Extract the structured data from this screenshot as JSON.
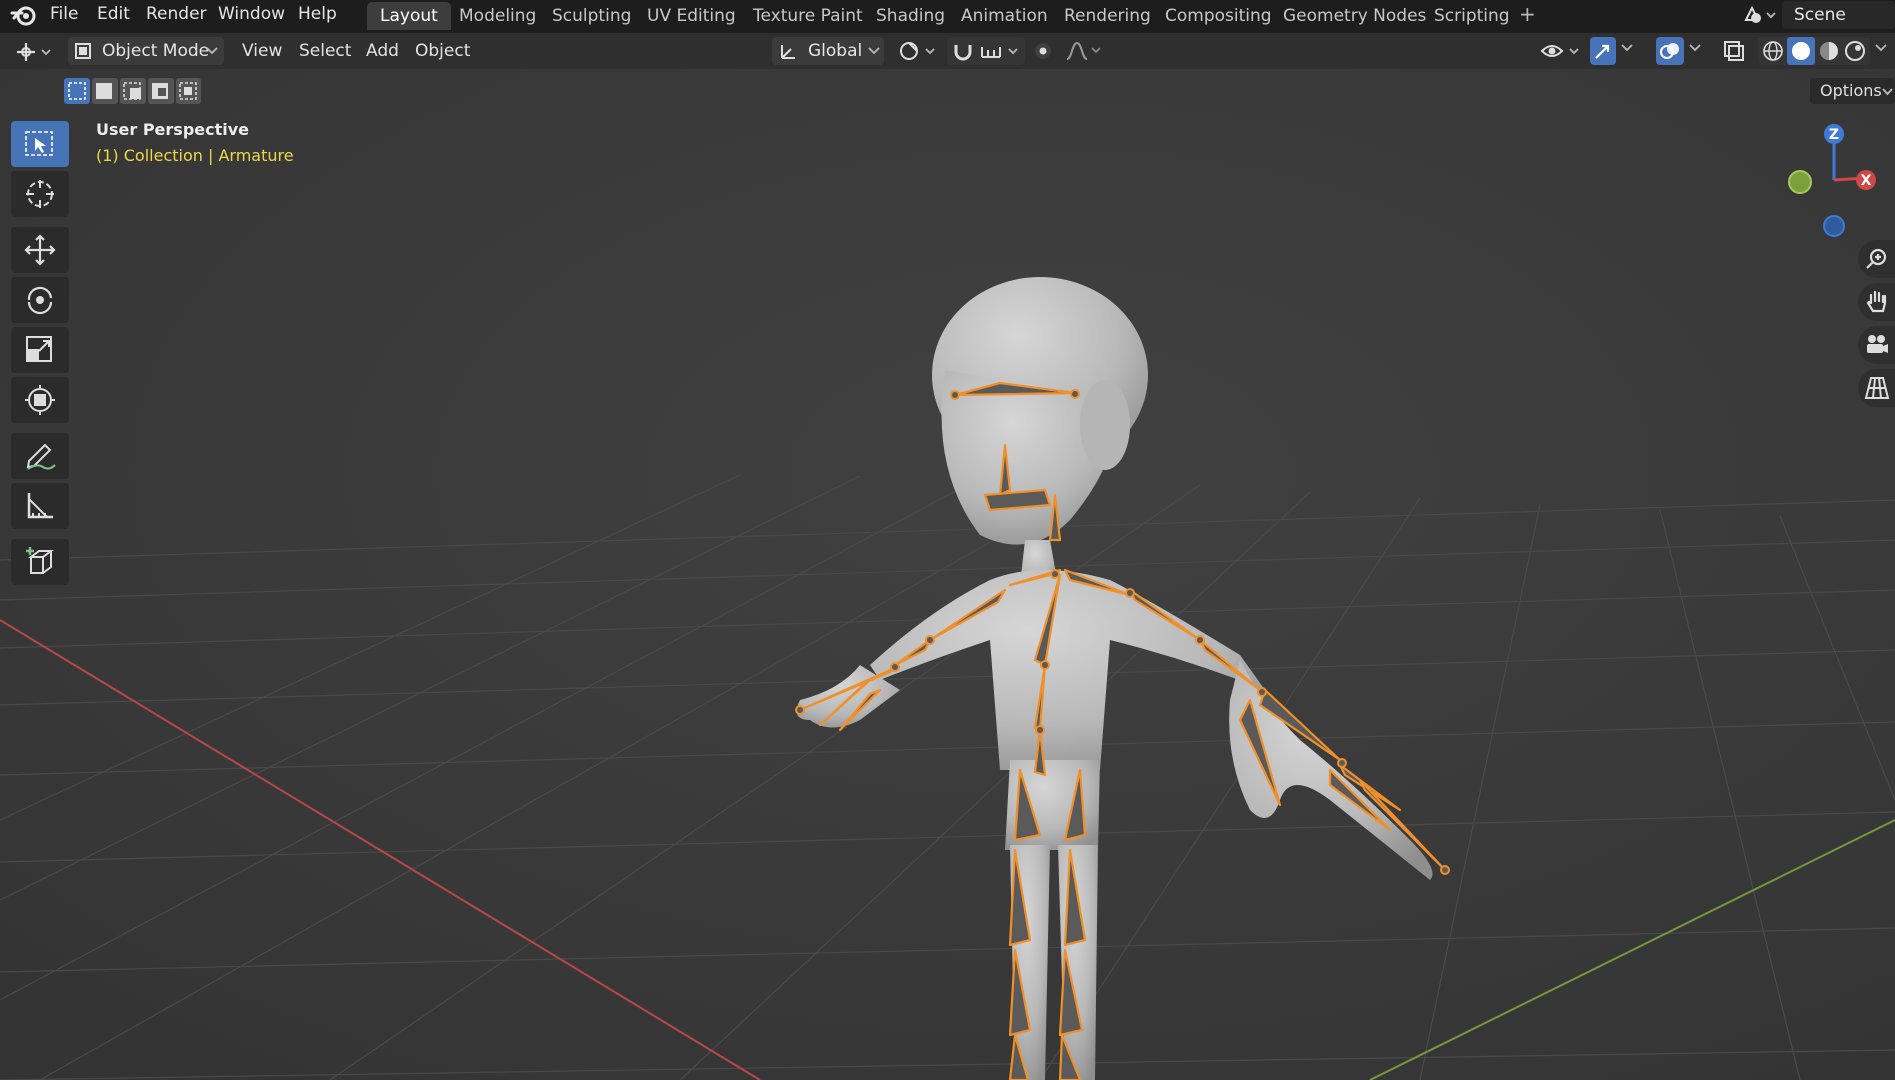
{
  "topbar": {
    "menus": [
      "File",
      "Edit",
      "Render",
      "Window",
      "Help"
    ],
    "workspaces": [
      "Layout",
      "Modeling",
      "Sculpting",
      "UV Editing",
      "Texture Paint",
      "Shading",
      "Animation",
      "Rendering",
      "Compositing",
      "Geometry Nodes",
      "Scripting"
    ],
    "active_workspace": "Layout",
    "add_workspace": "+",
    "scene": "Scene"
  },
  "header": {
    "mode": "Object Mode",
    "menus": [
      "View",
      "Select",
      "Add",
      "Object"
    ],
    "transform_orientation": "Global",
    "options": "Options"
  },
  "viewport": {
    "title": "User Perspective",
    "subtitle": "(1) Collection | Armature"
  },
  "gizmo": {
    "z": "Z",
    "x": "X"
  },
  "colors": {
    "accent": "#4773b8",
    "armature_outline": "#f0902a",
    "axis_x": "#c94848",
    "axis_y": "#7da13a",
    "collection_text": "#ecd84a"
  }
}
